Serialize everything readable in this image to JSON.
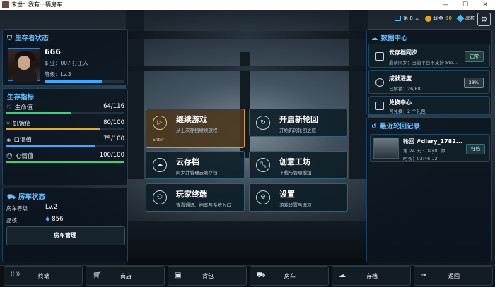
{
  "window": {
    "title": "末世：我有一辆房车",
    "minimize": "—",
    "maximize": "☐",
    "close": "✕"
  },
  "status": {
    "day": "第 8 天",
    "cash_label": "现金",
    "cash_value": "$0",
    "crystal_label": "晶核",
    "settings_icon": "gear-icon"
  },
  "survivor": {
    "header": "生存者状态",
    "name": "666",
    "job": "职业：007 打工人",
    "level": "等级：Lv.3",
    "level_progress": 0.72
  },
  "indicators": {
    "header": "生存指标",
    "items": [
      {
        "label": "生命值",
        "value": "64/116",
        "ratio": 0.55,
        "color": "#3fd07a",
        "icon": "heart-icon"
      },
      {
        "label": "饥饿值",
        "value": "80/100",
        "ratio": 0.8,
        "color": "#e3a93e",
        "icon": "fork-knife-icon"
      },
      {
        "label": "口渴值",
        "value": "75/100",
        "ratio": 0.75,
        "color": "#3fa8ff",
        "icon": "droplet-icon"
      },
      {
        "label": "心情值",
        "value": "100/100",
        "ratio": 1.0,
        "color": "#3fd07a",
        "icon": "smile-icon"
      }
    ]
  },
  "rv": {
    "header": "房车状态",
    "level_label": "房车等级",
    "level_value": "Lv.2",
    "crystal_label": "晶核",
    "crystal_value": "856",
    "manage_button": "房车管理"
  },
  "menu": {
    "continue": {
      "title": "继续游戏",
      "sub": "从上次存档继续旅程",
      "hint": "Enter"
    },
    "new_run": {
      "title": "开启新轮回",
      "sub": "开始新的轮回之旅"
    },
    "cloud": {
      "title": "云存档",
      "sub": "同步并管理云端存档"
    },
    "workshop": {
      "title": "创意工坊",
      "sub": "下载与管理模组"
    },
    "terminal": {
      "title": "玩家终端",
      "sub": "查看通讯、档案与系统入口"
    },
    "settings": {
      "title": "设置",
      "sub": "游戏设置与选项"
    }
  },
  "data_center": {
    "header": "数据中心",
    "cloud_sync": {
      "title": "云存档同步",
      "sub": "最新同步：当前平台不支持 Ste...",
      "tag": "正常"
    },
    "achievements": {
      "title": "成就进度",
      "sub": "已解锁：26/68",
      "tag": "38%"
    },
    "redeem": {
      "title": "兑换中心",
      "sub": "可兑换：2 个礼包"
    }
  },
  "recent": {
    "header": "最近轮回记录",
    "item": {
      "title": "轮回 #diary_1782...",
      "sub": "第 24 天 · Day0: 你...",
      "duration": "时长：03:46:12",
      "tag": "归档"
    }
  },
  "bottom_nav": [
    {
      "label": "终端",
      "icon": "signal-icon"
    },
    {
      "label": "商店",
      "icon": "cart-icon"
    },
    {
      "label": "背包",
      "icon": "backpack-icon"
    },
    {
      "label": "房车",
      "icon": "truck-icon"
    },
    {
      "label": "存档",
      "icon": "cloud-icon"
    },
    {
      "label": "返回",
      "icon": "exit-icon"
    }
  ]
}
